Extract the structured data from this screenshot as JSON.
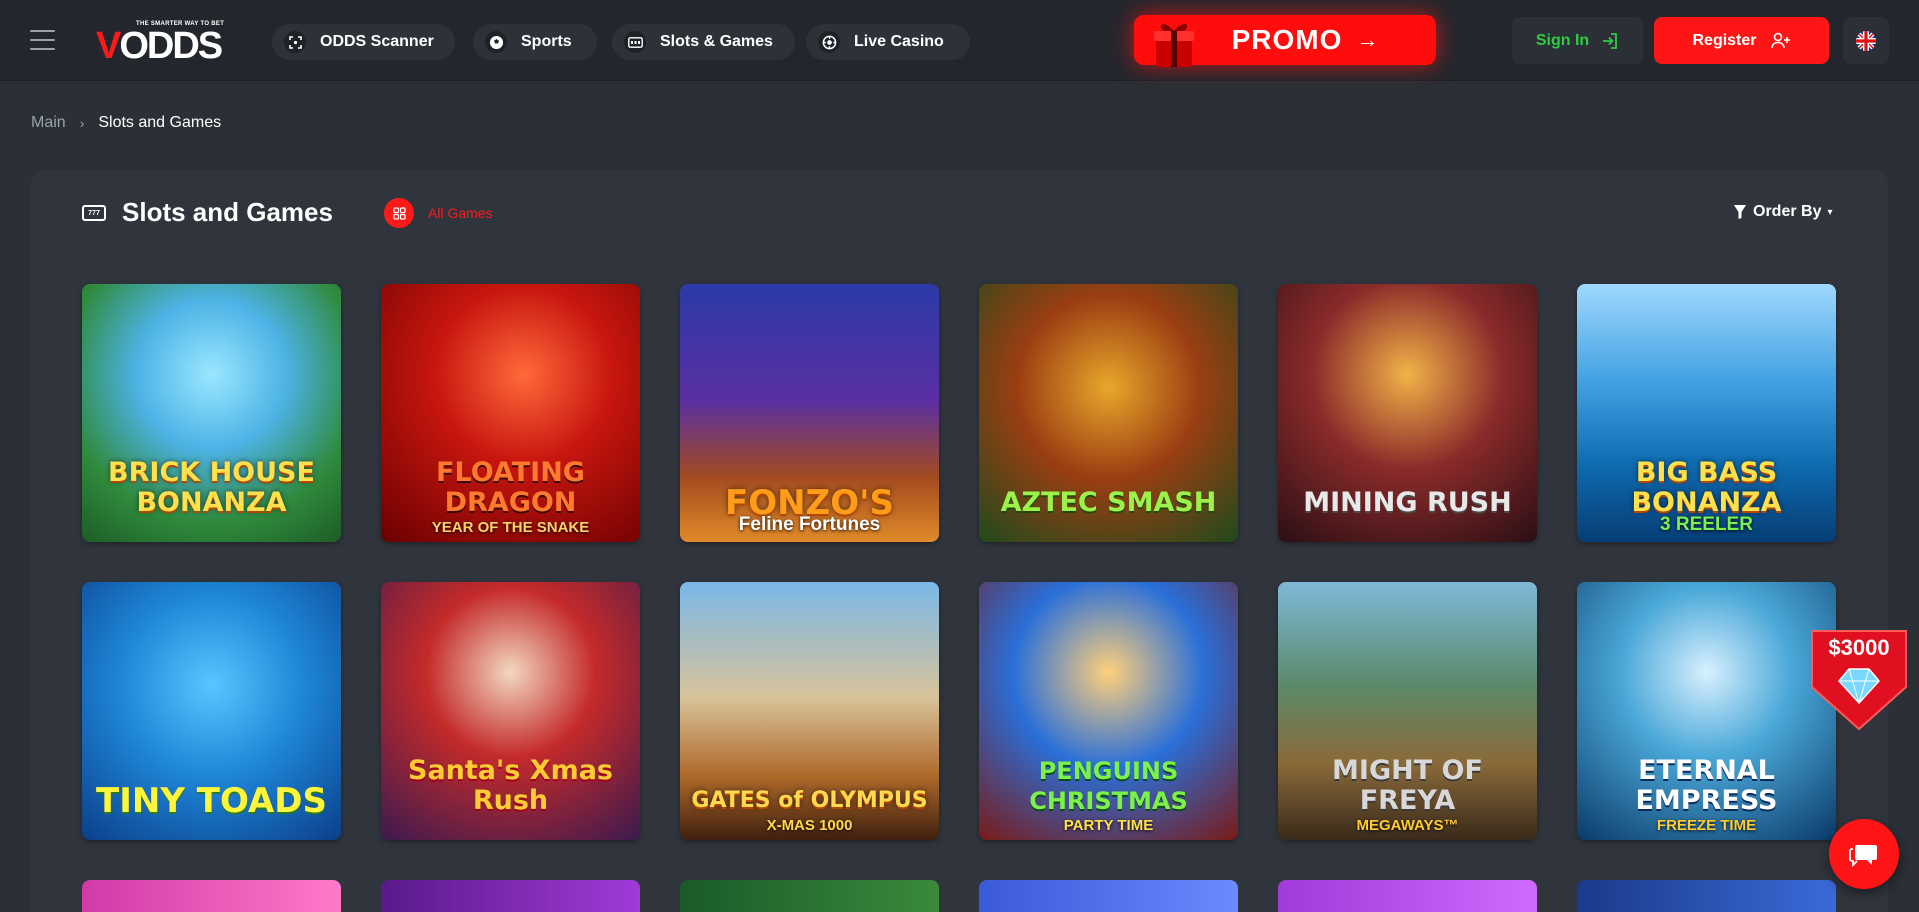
{
  "header": {
    "logo_tagline": "THE SMARTER WAY TO BET",
    "logo_text_v": "V",
    "logo_text_rest": "ODDS",
    "nav": [
      {
        "label": "ODDS Scanner",
        "icon": "scanner-icon"
      },
      {
        "label": "Sports",
        "icon": "soccer-ball-icon"
      },
      {
        "label": "Slots & Games",
        "icon": "slot-machine-icon"
      },
      {
        "label": "Live Casino",
        "icon": "casino-chip-icon"
      }
    ],
    "promo_label": "PROMO",
    "signin_label": "Sign In",
    "register_label": "Register"
  },
  "breadcrumb": {
    "main": "Main",
    "current": "Slots and Games"
  },
  "section": {
    "icon_text": "777",
    "title": "Slots and Games",
    "filter_label": "All Games",
    "order_by_label": "Order By"
  },
  "games": [
    {
      "title": "BRICK HOUSE BONANZA",
      "subtitle": ""
    },
    {
      "title": "FLOATING DRAGON",
      "subtitle": "YEAR OF THE SNAKE"
    },
    {
      "title": "FONZO'S",
      "subtitle": "Feline Fortunes"
    },
    {
      "title": "AZTEC SMASH",
      "subtitle": ""
    },
    {
      "title": "MINING RUSH",
      "subtitle": ""
    },
    {
      "title": "BIG BASS BONANZA",
      "subtitle": "3 REELER"
    },
    {
      "title": "TINY TOADS",
      "subtitle": ""
    },
    {
      "title": "Santa's Xmas Rush",
      "subtitle": ""
    },
    {
      "title": "GATES of OLYMPUS",
      "subtitle": "X-MAS 1000"
    },
    {
      "title": "PENGUINS CHRISTMAS",
      "subtitle": "PARTY TIME"
    },
    {
      "title": "MIGHT OF FREYA",
      "subtitle": "MEGAWAYS™"
    },
    {
      "title": "ETERNAL EMPRESS",
      "subtitle": "FREEZE TIME"
    }
  ],
  "jackpot_badge": "$3000",
  "colors": {
    "accent": "#ff1515",
    "signin_green": "#2ecc40",
    "background": "#2b2f36",
    "header_bg": "#23272d",
    "panel_bg": "#30353d"
  }
}
